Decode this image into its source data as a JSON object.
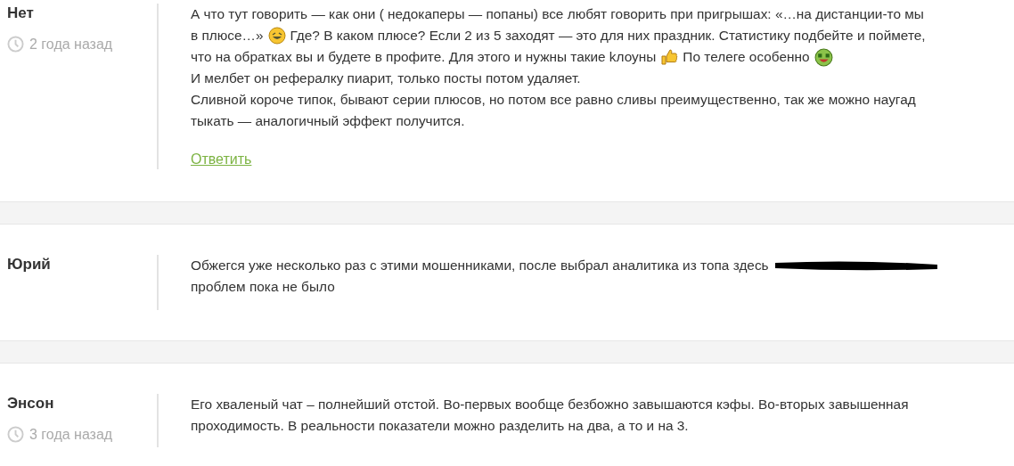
{
  "comments": [
    {
      "author": "Нет",
      "time": "2 года назад",
      "lines": [
        [
          {
            "kind": "text",
            "text": "А что тут говорить — как они ( недокаперы — попаны) все любят говорить при пригрышах: «…на дистанции-то мы"
          }
        ],
        [
          {
            "kind": "text",
            "text": "в плюсе…»"
          },
          {
            "kind": "laugh"
          },
          {
            "kind": "text",
            "text": "Где? В каком плюсе? Если 2 из 5 заходят — это для них праздник. Статистику подбейте и поймете,"
          }
        ],
        [
          {
            "kind": "text",
            "text": "что на обратках вы и будете в профите. Для этого и нужны такие kлоуны"
          },
          {
            "kind": "thumb"
          },
          {
            "kind": "text",
            "text": "По телеге особенно"
          },
          {
            "kind": "money"
          }
        ],
        [
          {
            "kind": "text",
            "text": "И мелбет он рефералку пиарит, только посты потом удаляет."
          }
        ],
        [
          {
            "kind": "text",
            "text": "Сливной короче типок, бывают серии плюсов, но потом все равно сливы преимущественно, так же можно наугад"
          }
        ],
        [
          {
            "kind": "text",
            "text": "тыкать — аналогичный эффект получится."
          }
        ]
      ],
      "reply": "Ответить"
    },
    {
      "author": "Юрий",
      "lines": [
        [
          {
            "kind": "text",
            "text": "Обжегся уже несколько раз с этими мошенниками, после выбрал аналитика из топа здесь"
          },
          {
            "kind": "redacted"
          }
        ],
        [
          {
            "kind": "text",
            "text": "проблем пока не было"
          }
        ]
      ]
    },
    {
      "author": "Энсон",
      "time": "3 года назад",
      "lines": [
        [
          {
            "kind": "text",
            "text": "Его хваленый чат – полнейший отстой. Во-первых вообще безбожно завышаются кэфы. Во-вторых завышенная"
          }
        ],
        [
          {
            "kind": "text",
            "text": "проходимость. В реальности показатели можно разделить на два, а то и на 3."
          }
        ]
      ]
    }
  ]
}
